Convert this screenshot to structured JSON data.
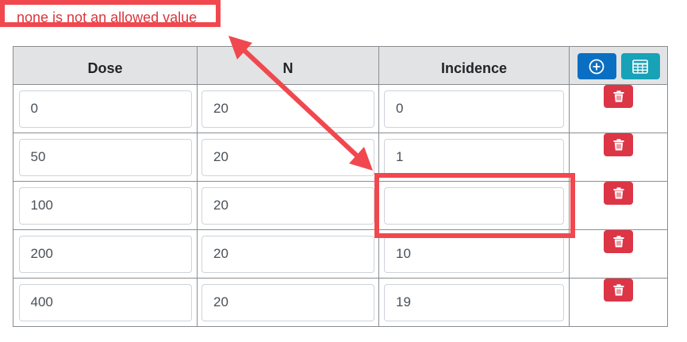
{
  "error": {
    "message": "none is not an allowed value"
  },
  "table": {
    "headers": {
      "dose": "Dose",
      "n": "N",
      "incidence": "Incidence"
    },
    "rows": [
      {
        "dose": "0",
        "n": "20",
        "incidence": "0"
      },
      {
        "dose": "50",
        "n": "20",
        "incidence": "1"
      },
      {
        "dose": "100",
        "n": "20",
        "incidence": ""
      },
      {
        "dose": "200",
        "n": "20",
        "incidence": "10"
      },
      {
        "dose": "400",
        "n": "20",
        "incidence": "19"
      }
    ]
  },
  "icons": {
    "add_row": "plus-circle-icon",
    "import_table": "table-icon",
    "delete_row": "trash-icon"
  },
  "colors": {
    "annotation": "#f0484e",
    "error_text": "#d9363e",
    "add_button": "#0a6fc2",
    "table_button": "#17a2b8",
    "delete_button": "#dc3545",
    "header_bg": "#e2e3e5"
  }
}
